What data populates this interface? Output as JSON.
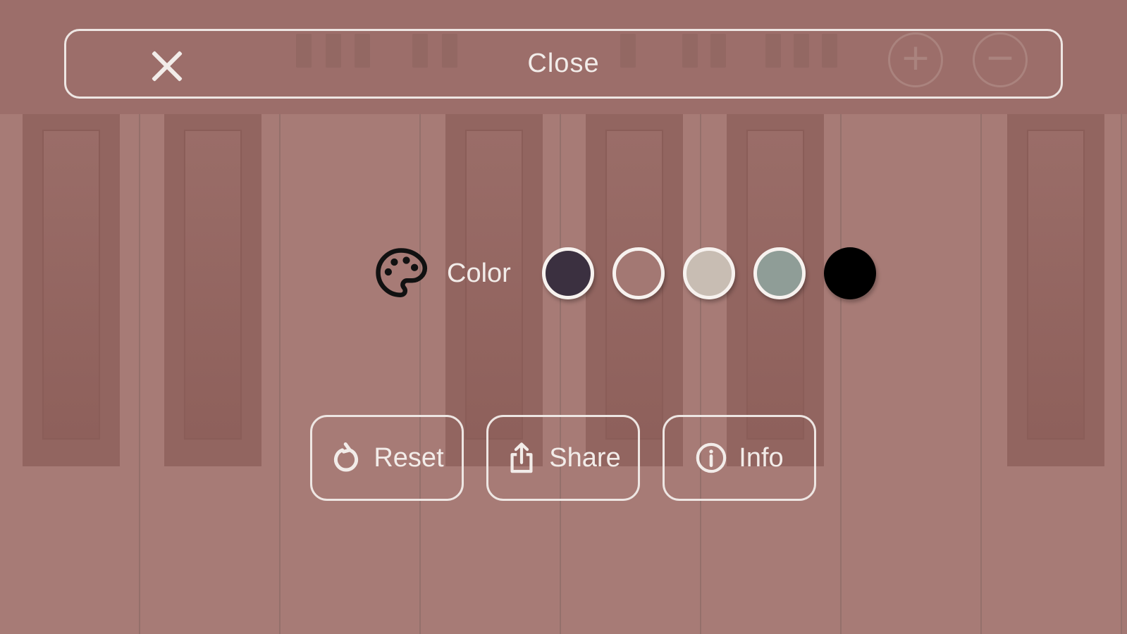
{
  "close_bar": {
    "label": "Close",
    "icon": "close-icon"
  },
  "color_picker": {
    "label": "Color",
    "icon": "palette-icon",
    "swatches": [
      {
        "name": "dark-plum",
        "color": "#3b3040"
      },
      {
        "name": "mauve",
        "color": "#a37873"
      },
      {
        "name": "beige",
        "color": "#c8bdb3"
      },
      {
        "name": "sage",
        "color": "#8f9d97"
      },
      {
        "name": "black",
        "color": "#000000"
      }
    ]
  },
  "actions": [
    {
      "label": "Reset",
      "icon": "reset-icon"
    },
    {
      "label": "Share",
      "icon": "share-icon"
    },
    {
      "label": "Info",
      "icon": "info-icon"
    }
  ],
  "colors": {
    "background": "#a37873",
    "foreground": "#f2ece9"
  }
}
